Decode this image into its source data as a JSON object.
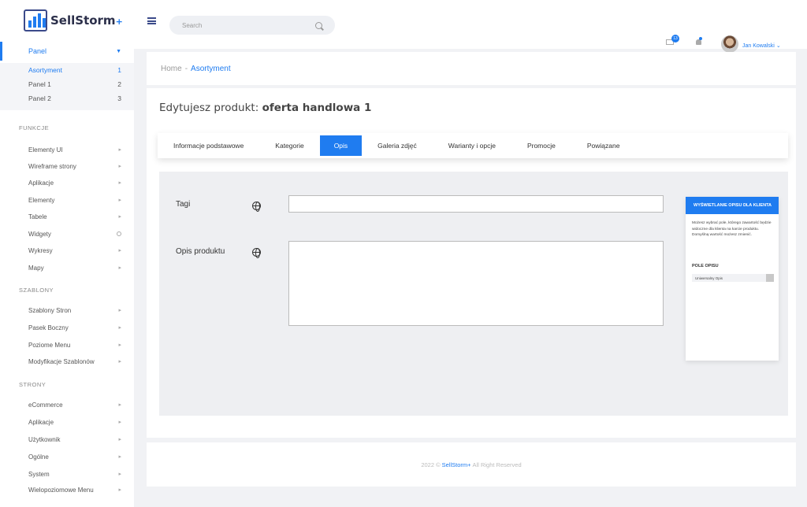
{
  "app": {
    "brand": "SellStorm",
    "brand_suffix": "+"
  },
  "sidebar": {
    "panel_label": "Panel",
    "subitems": [
      {
        "label": "Asortyment",
        "count": "1"
      },
      {
        "label": "Panel 1",
        "count": "2"
      },
      {
        "label": "Panel 2",
        "count": "3"
      }
    ],
    "sections": {
      "funkcje": "FUNKCJE",
      "szablony": "SZABLONY",
      "strony": "STRONY"
    },
    "funkcje_items": [
      "Elementy UI",
      "Wireframe strony",
      "Aplikacje",
      "Elementy",
      "Tabele",
      "Widgety",
      "Wykresy",
      "Mapy"
    ],
    "szablony_items": [
      "Szablony Stron",
      "Pasek Boczny",
      "Poziome  Menu",
      "Modyfikacje Szablonów"
    ],
    "strony_items": [
      "eCommerce",
      "Aplikacje",
      "Użytkownik",
      "Ogólne",
      "System",
      "Wielopoziomowe Menu"
    ]
  },
  "topbar": {
    "search_placeholder": "Search",
    "mail_badge": "13",
    "user_name": "Jan Kowalski"
  },
  "breadcrumb": {
    "home": "Home",
    "separator": "-",
    "current": "Asortyment"
  },
  "page": {
    "title_prefix": "Edytujesz produkt:",
    "title_product": "oferta handlowa 1",
    "tabs": [
      "Informacje podstawowe",
      "Kategorie",
      "Opis",
      "Galeria zdjęć",
      "Warianty i opcje",
      "Promocje",
      "Powiązane"
    ],
    "active_tab": "Opis"
  },
  "form": {
    "tags_label": "Tagi",
    "desc_label": "Opis produktu",
    "tags_value": "",
    "desc_value": ""
  },
  "side_panel": {
    "header": "WYŚWIETLANIE OPISU DLA KLIENTA",
    "text": "Możesz wybrać pole, którego zawartość będzie widoczne dla klienta na karcie produktu. Domyślną wartość możesz zmienić.",
    "field_label": "POLE OPISU",
    "select_value": "Uniwersalny Opis"
  },
  "footer": {
    "year": "2022 ©",
    "brand": "SellStorm+",
    "rights": "All Right Reserved"
  },
  "colors": {
    "accent": "#1f7cf0",
    "background": "#f1f2f5"
  }
}
